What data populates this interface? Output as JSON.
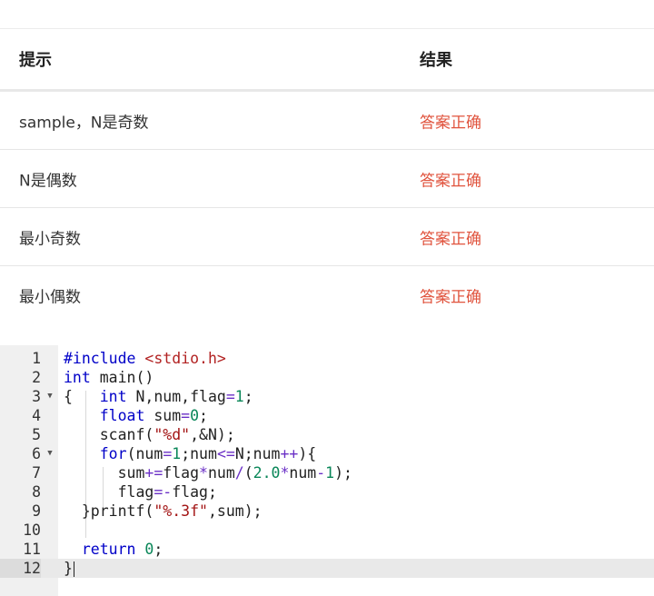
{
  "table": {
    "header": {
      "hint": "提示",
      "result": "结果"
    },
    "rows": [
      {
        "hint": "sample，N是奇数",
        "result": "答案正确"
      },
      {
        "hint": "N是偶数",
        "result": "答案正确"
      },
      {
        "hint": "最小奇数",
        "result": "答案正确"
      },
      {
        "hint": "最小偶数",
        "result": "答案正确"
      }
    ]
  },
  "colors": {
    "result_ok": "#e0533d"
  },
  "editor": {
    "line_numbers": [
      "1",
      "2",
      "3",
      "4",
      "5",
      "6",
      "7",
      "8",
      "9",
      "10",
      "11",
      "12"
    ],
    "folded_lines": [
      "3",
      "6"
    ],
    "active_line": "12",
    "lines": [
      "#include <stdio.h>",
      "int main()",
      "{   int N,num,flag=1;",
      "    float sum=0;",
      "    scanf(\"%d\",&N);",
      "    for(num=1;num<=N;num++){",
      "      sum+=flag*num/(2.0*num-1);",
      "      flag=-flag;",
      "  }printf(\"%.3f\",sum);",
      "",
      "  return 0;",
      "}"
    ]
  }
}
